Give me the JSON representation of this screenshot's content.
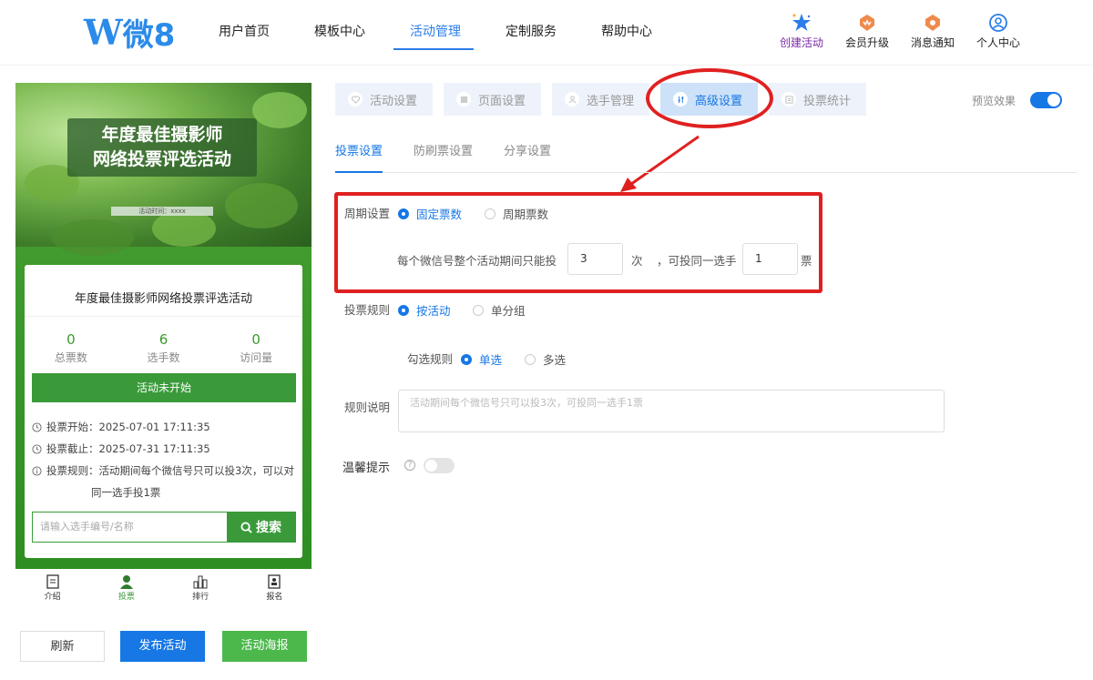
{
  "logo": {
    "w": "W",
    "text": "微8"
  },
  "nav": [
    "用户首页",
    "模板中心",
    "活动管理",
    "定制服务",
    "帮助中心"
  ],
  "top_icons": [
    "创建活动",
    "会员升级",
    "消息通知",
    "个人中心"
  ],
  "preview": {
    "banner_title_1": "年度最佳摄影师",
    "banner_title_2": "网络投票评选活动",
    "banner_time": "活动时间：xxxx",
    "card_title": "年度最佳摄影师网络投票评选活动",
    "stats": [
      {
        "n": "0",
        "l": "总票数"
      },
      {
        "n": "6",
        "l": "选手数"
      },
      {
        "n": "0",
        "l": "访问量"
      }
    ],
    "start_btn": "活动未开始",
    "vote_start": "投票开始：2025-07-01 17:11:35",
    "vote_end": "投票截止：2025-07-31 17:11:35",
    "rule_1": "投票规则：活动期间每个微信号只可以投3次，可以对",
    "rule_2": "同一选手投1票",
    "search_placeholder": "请输入选手编号/名称",
    "search_btn": "搜索",
    "tabbar": [
      "介绍",
      "投票",
      "排行",
      "报名"
    ]
  },
  "bottom_btns": [
    "刷新",
    "发布活动",
    "活动海报"
  ],
  "steps": [
    "活动设置",
    "页面设置",
    "选手管理",
    "高级设置",
    "投票统计"
  ],
  "preview_toggle": "预览效果",
  "subtabs": [
    "投票设置",
    "防刷票设置",
    "分享设置"
  ],
  "form": {
    "period_label": "周期设置",
    "period_opt1": "固定票数",
    "period_opt2": "周期票数",
    "each_text": "每个微信号整个活动期间只能投",
    "times_value": "3",
    "times_unit": "次",
    "same_text": "，可投同一选手",
    "votes_value": "1",
    "votes_unit": "票",
    "rule_label": "投票规则",
    "rule_opt1": "按活动",
    "rule_opt2": "单分组",
    "select_label": "勾选规则",
    "select_opt1": "单选",
    "select_opt2": "多选",
    "desc_label": "规则说明",
    "desc_value": "活动期间每个微信号只可以投3次，可投同一选手1票",
    "tip_label": "温馨提示",
    "help": "?"
  }
}
